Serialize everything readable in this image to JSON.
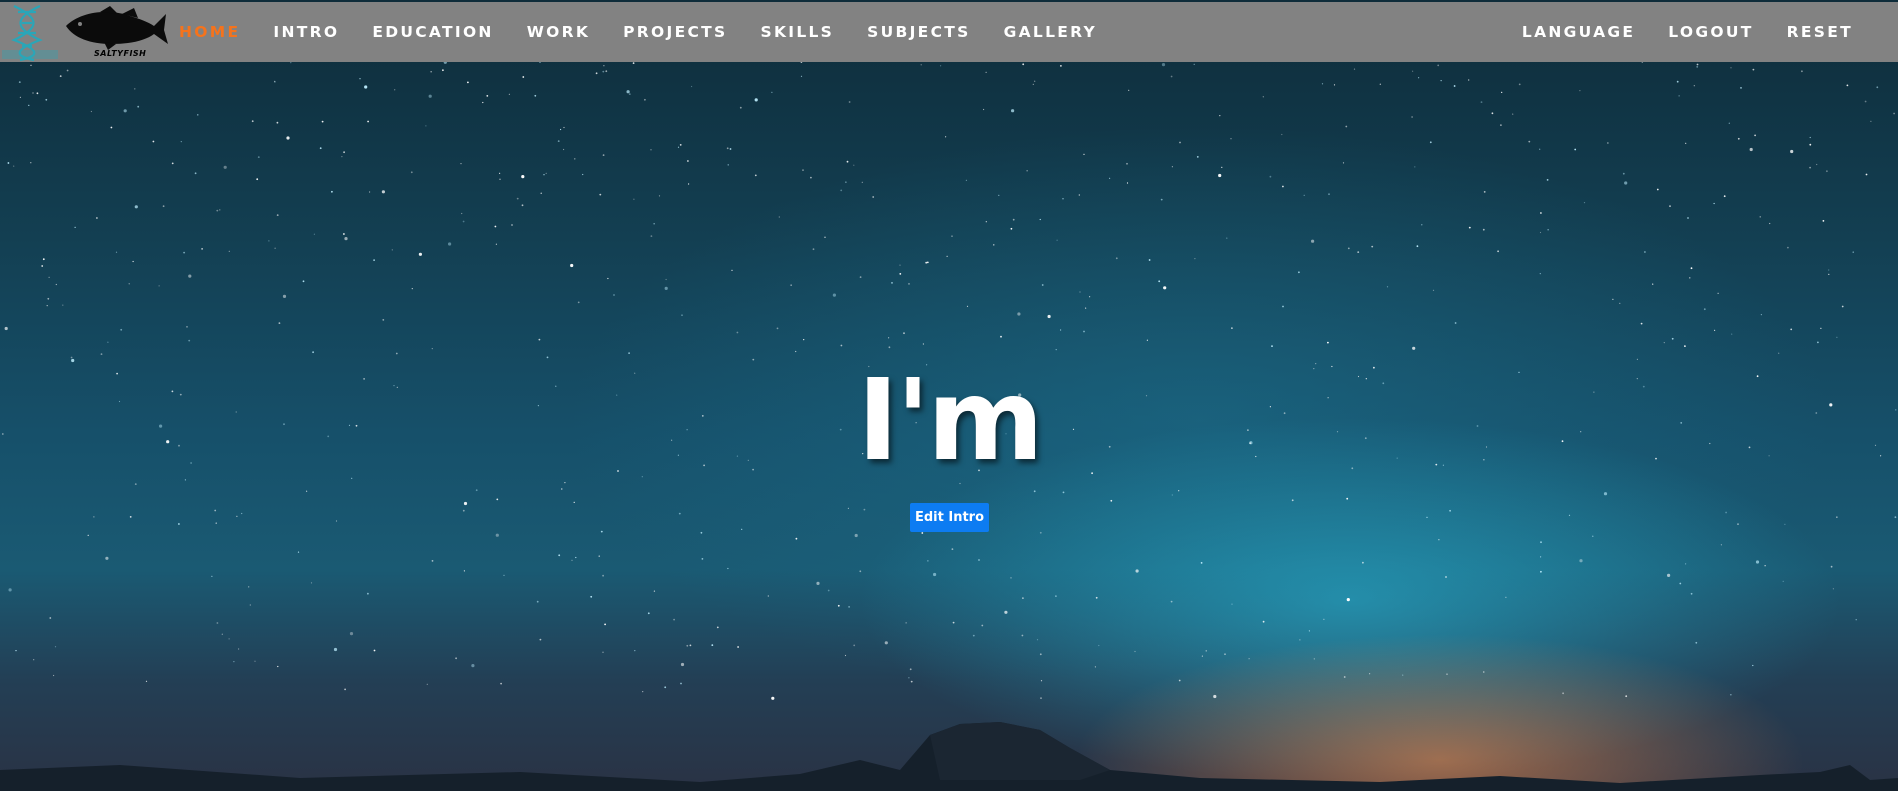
{
  "navbar": {
    "logo_dna_caption": "",
    "logo_fish_caption": "SALTYFISH",
    "left_items": [
      {
        "label": "HOME",
        "active": true
      },
      {
        "label": "INTRO",
        "active": false
      },
      {
        "label": "EDUCATION",
        "active": false
      },
      {
        "label": "WORK",
        "active": false
      },
      {
        "label": "PROJECTS",
        "active": false
      },
      {
        "label": "SKILLS",
        "active": false
      },
      {
        "label": "SUBJECTS",
        "active": false
      },
      {
        "label": "GALLERY",
        "active": false
      }
    ],
    "right_items": [
      {
        "label": "LANGUAGE"
      },
      {
        "label": "LOGOUT"
      },
      {
        "label": "RESET"
      }
    ]
  },
  "hero": {
    "title": "I'm",
    "edit_button_label": "Edit Intro"
  },
  "colors": {
    "navbar_bg": "#828282",
    "active_nav": "#f5731c",
    "button_bg": "#0d7cf2",
    "dna_logo": "#2aa6b8"
  },
  "icons": {
    "dna_logo": "dna-logo-icon",
    "fish_logo": "fish-logo-icon"
  }
}
